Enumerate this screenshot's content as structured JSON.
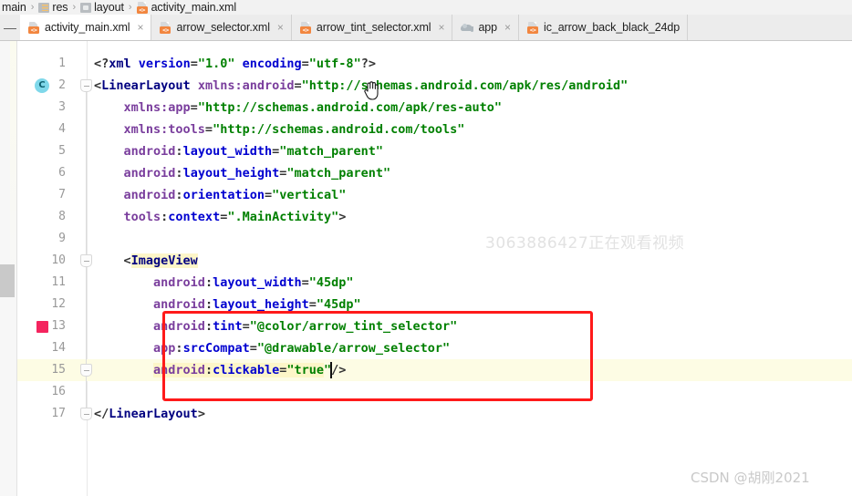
{
  "breadcrumb": {
    "items": [
      {
        "label": "main",
        "icon": "none"
      },
      {
        "label": "res",
        "icon": "res-folder-icon"
      },
      {
        "label": "layout",
        "icon": "directory-icon"
      },
      {
        "label": "activity_main.xml",
        "icon": "xml-file-icon"
      }
    ],
    "separator": "›"
  },
  "tabbar": {
    "collapse_glyph": "—",
    "close_glyph": "×",
    "tabs": [
      {
        "label": "activity_main.xml",
        "icon": "xml-file-icon",
        "active": true
      },
      {
        "label": "arrow_selector.xml",
        "icon": "xml-file-icon",
        "active": false
      },
      {
        "label": "arrow_tint_selector.xml",
        "icon": "xml-file-icon",
        "active": false
      },
      {
        "label": "app",
        "icon": "gradle-module-icon",
        "active": false
      },
      {
        "label": "ic_arrow_back_black_24dp",
        "icon": "xml-file-icon",
        "active": false
      }
    ]
  },
  "editor": {
    "language": "xml",
    "current_line": 15,
    "lines": [
      {
        "n": "1",
        "indent": 0,
        "tokens": [
          {
            "t": "<?",
            "c": "punct"
          },
          {
            "t": "xml",
            "c": "tag"
          },
          {
            "t": " ",
            "c": "punct"
          },
          {
            "t": "version",
            "c": "ns"
          },
          {
            "t": "=",
            "c": "punct"
          },
          {
            "t": "\"1.0\"",
            "c": "val"
          },
          {
            "t": " ",
            "c": "punct"
          },
          {
            "t": "encoding",
            "c": "ns"
          },
          {
            "t": "=",
            "c": "punct"
          },
          {
            "t": "\"utf-8\"",
            "c": "val"
          },
          {
            "t": "?>",
            "c": "punct"
          }
        ]
      },
      {
        "n": "2",
        "indent": 0,
        "tokens": [
          {
            "t": "<",
            "c": "punct"
          },
          {
            "t": "LinearLayout",
            "c": "tag"
          },
          {
            "t": " ",
            "c": "punct"
          },
          {
            "t": "xmlns:android",
            "c": "attr"
          },
          {
            "t": "=",
            "c": "punct"
          },
          {
            "t": "\"http://schemas.android.com/apk/res/android\"",
            "c": "val"
          }
        ]
      },
      {
        "n": "3",
        "indent": 4,
        "tokens": [
          {
            "t": "xmlns:app",
            "c": "attr"
          },
          {
            "t": "=",
            "c": "punct"
          },
          {
            "t": "\"http://schemas.android.com/apk/res-auto\"",
            "c": "val"
          }
        ]
      },
      {
        "n": "4",
        "indent": 4,
        "tokens": [
          {
            "t": "xmlns:tools",
            "c": "attr"
          },
          {
            "t": "=",
            "c": "punct"
          },
          {
            "t": "\"http://schemas.android.com/tools\"",
            "c": "val"
          }
        ]
      },
      {
        "n": "5",
        "indent": 4,
        "tokens": [
          {
            "t": "android",
            "c": "attr"
          },
          {
            "t": ":",
            "c": "punct"
          },
          {
            "t": "layout_width",
            "c": "ns"
          },
          {
            "t": "=",
            "c": "punct"
          },
          {
            "t": "\"match_parent\"",
            "c": "val"
          }
        ]
      },
      {
        "n": "6",
        "indent": 4,
        "tokens": [
          {
            "t": "android",
            "c": "attr"
          },
          {
            "t": ":",
            "c": "punct"
          },
          {
            "t": "layout_height",
            "c": "ns"
          },
          {
            "t": "=",
            "c": "punct"
          },
          {
            "t": "\"match_parent\"",
            "c": "val"
          }
        ]
      },
      {
        "n": "7",
        "indent": 4,
        "tokens": [
          {
            "t": "android",
            "c": "attr"
          },
          {
            "t": ":",
            "c": "punct"
          },
          {
            "t": "orientation",
            "c": "ns"
          },
          {
            "t": "=",
            "c": "punct"
          },
          {
            "t": "\"vertical\"",
            "c": "val"
          }
        ]
      },
      {
        "n": "8",
        "indent": 4,
        "tokens": [
          {
            "t": "tools",
            "c": "attr"
          },
          {
            "t": ":",
            "c": "punct"
          },
          {
            "t": "context",
            "c": "ns"
          },
          {
            "t": "=",
            "c": "punct"
          },
          {
            "t": "\".MainActivity\"",
            "c": "val"
          },
          {
            "t": ">",
            "c": "punct"
          }
        ]
      },
      {
        "n": "9",
        "indent": 0,
        "tokens": []
      },
      {
        "n": "10",
        "indent": 4,
        "tokens": [
          {
            "t": "<",
            "c": "punct"
          },
          {
            "t": "ImageView",
            "c": "tag",
            "hl": true
          }
        ]
      },
      {
        "n": "11",
        "indent": 8,
        "tokens": [
          {
            "t": "android",
            "c": "attr"
          },
          {
            "t": ":",
            "c": "punct"
          },
          {
            "t": "layout_width",
            "c": "ns"
          },
          {
            "t": "=",
            "c": "punct"
          },
          {
            "t": "\"45dp\"",
            "c": "val"
          }
        ]
      },
      {
        "n": "12",
        "indent": 8,
        "tokens": [
          {
            "t": "android",
            "c": "attr"
          },
          {
            "t": ":",
            "c": "punct"
          },
          {
            "t": "layout_height",
            "c": "ns"
          },
          {
            "t": "=",
            "c": "punct"
          },
          {
            "t": "\"45dp\"",
            "c": "val"
          }
        ]
      },
      {
        "n": "13",
        "indent": 8,
        "tokens": [
          {
            "t": "android",
            "c": "attr"
          },
          {
            "t": ":",
            "c": "punct"
          },
          {
            "t": "tint",
            "c": "ns"
          },
          {
            "t": "=",
            "c": "punct"
          },
          {
            "t": "\"@color/arrow_tint_selector\"",
            "c": "val"
          }
        ]
      },
      {
        "n": "14",
        "indent": 8,
        "tokens": [
          {
            "t": "app",
            "c": "attr"
          },
          {
            "t": ":",
            "c": "punct"
          },
          {
            "t": "srcCompat",
            "c": "ns"
          },
          {
            "t": "=",
            "c": "punct"
          },
          {
            "t": "\"@drawable/arrow_selector\"",
            "c": "val"
          }
        ]
      },
      {
        "n": "15",
        "indent": 8,
        "tokens": [
          {
            "t": "android",
            "c": "attr",
            "hl": true
          },
          {
            "t": ":",
            "c": "punct",
            "hl": true
          },
          {
            "t": "clickable",
            "c": "ns",
            "hl": true
          },
          {
            "t": "=",
            "c": "punct",
            "hl": true
          },
          {
            "t": "\"true",
            "c": "val",
            "hl": true
          },
          {
            "t": "\"",
            "c": "val"
          },
          {
            "t": "/>",
            "c": "punct"
          }
        ]
      },
      {
        "n": "16",
        "indent": 0,
        "tokens": []
      },
      {
        "n": "17",
        "indent": 0,
        "tokens": [
          {
            "t": "</",
            "c": "punct"
          },
          {
            "t": "LinearLayout",
            "c": "tag"
          },
          {
            "t": ">",
            "c": "punct"
          }
        ]
      }
    ],
    "gutter_markers": [
      {
        "line": 2,
        "type": "css-color-indicator",
        "label": "C",
        "color": "#7fd8ea"
      },
      {
        "line": 13,
        "type": "color-swatch",
        "label": "",
        "color": "#f4245e"
      }
    ],
    "fold_markers": [
      {
        "line": 2
      },
      {
        "line": 10
      },
      {
        "line": 15
      },
      {
        "line": 17
      }
    ]
  },
  "annotation": {
    "type": "red-rectangle",
    "color": "#ff1a1a",
    "covers_lines": [
      13,
      14,
      15
    ]
  },
  "watermarks": {
    "center": "3063886427正在观看视频",
    "bottom_right": "CSDN @胡刚2021"
  }
}
